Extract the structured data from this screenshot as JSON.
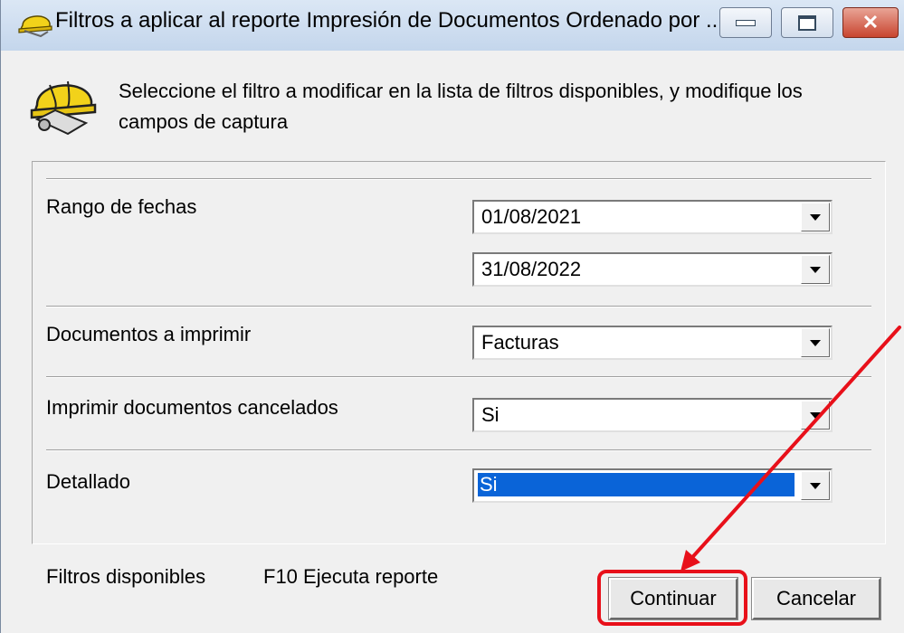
{
  "window": {
    "title": "Filtros a aplicar al reporte Impresión de Documentos Ordenado por ..."
  },
  "instruction": "Seleccione el filtro a modificar  en la lista de filtros disponibles, y modifique los campos de  captura",
  "filters": {
    "rango_label": "Rango de fechas",
    "fecha_inicio": "01/08/2021",
    "fecha_fin": "31/08/2022",
    "documentos_label": "Documentos a imprimir",
    "documentos_value": "Facturas",
    "cancelados_label": "Imprimir documentos cancelados",
    "cancelados_value": "Si",
    "detallado_label": "Detallado",
    "detallado_value": "Si"
  },
  "status": {
    "left": "Filtros disponibles",
    "hint": "F10 Ejecuta reporte"
  },
  "buttons": {
    "continuar": "Continuar",
    "cancelar": "Cancelar"
  },
  "colors": {
    "annotation": "#e8101a",
    "selection": "#0a64d8"
  }
}
